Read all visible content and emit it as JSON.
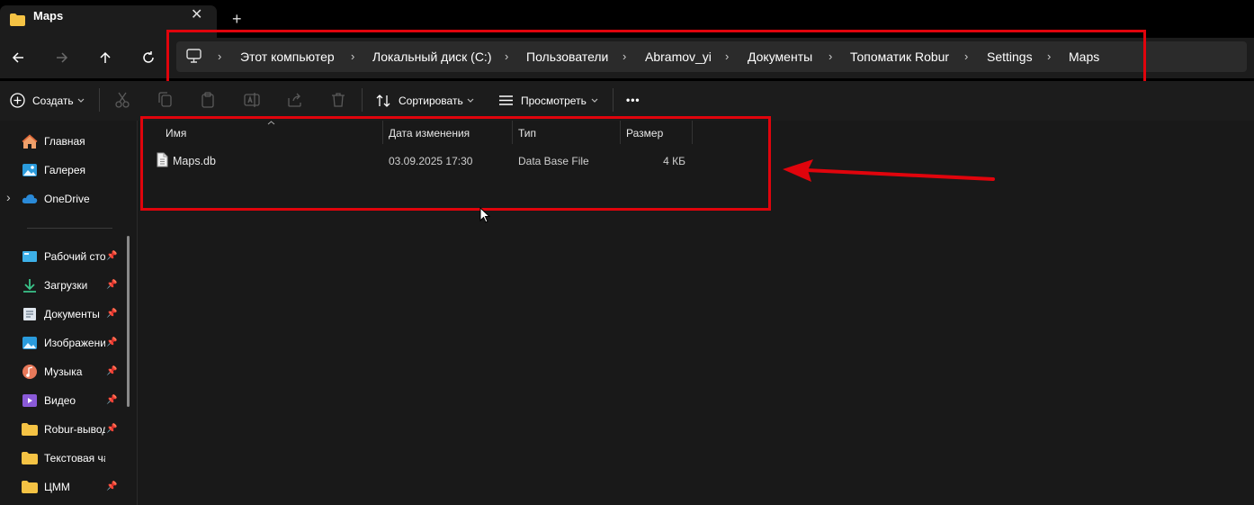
{
  "window": {
    "tab_title": "Maps",
    "close_glyph": "✕",
    "new_tab_glyph": "+"
  },
  "nav": {
    "buttons": [
      "back",
      "forward",
      "up",
      "refresh"
    ],
    "breadcrumbs": [
      "Этот компьютер",
      "Локальный диск (C:)",
      "Пользователи",
      "Abramov_yi",
      "Документы",
      "Топоматик Robur",
      "Settings",
      "Maps"
    ],
    "separator": "›"
  },
  "toolbar": {
    "create_label": "Создать",
    "sort_label": "Сортировать",
    "view_label": "Просмотреть",
    "more_label": "•••"
  },
  "sidebar": {
    "items": [
      {
        "label": "Главная",
        "icon": "home-icon",
        "pinned": false
      },
      {
        "label": "Галерея",
        "icon": "gallery-icon",
        "pinned": false
      },
      {
        "label": "OneDrive",
        "icon": "cloud-icon",
        "pinned": false
      },
      {
        "label": "Рабочий стол",
        "icon": "desktop-icon",
        "pinned": true
      },
      {
        "label": "Загрузки",
        "icon": "download-icon",
        "pinned": true
      },
      {
        "label": "Документы",
        "icon": "documents-icon",
        "pinned": true
      },
      {
        "label": "Изображения",
        "icon": "pictures-icon",
        "pinned": true
      },
      {
        "label": "Музыка",
        "icon": "music-icon",
        "pinned": true
      },
      {
        "label": "Видео",
        "icon": "video-icon",
        "pinned": true
      },
      {
        "label": "Robur-выводы",
        "icon": "folder-icon",
        "pinned": true
      },
      {
        "label": "Текстовая часть",
        "icon": "folder-icon",
        "pinned": false
      },
      {
        "label": "ЦММ",
        "icon": "folder-icon",
        "pinned": true
      }
    ],
    "expand_glyph": "›"
  },
  "file_list": {
    "columns": [
      "Имя",
      "Дата изменения",
      "Тип",
      "Размер"
    ],
    "rows": [
      {
        "name": "Maps.db",
        "modified": "03.09.2025 17:30",
        "type": "Data Base File",
        "size": "4 КБ"
      }
    ]
  },
  "colors": {
    "annotation_red": "#e0040c",
    "folder_yellow": "#f5c344",
    "accent_blue": "#2a9bdc"
  }
}
